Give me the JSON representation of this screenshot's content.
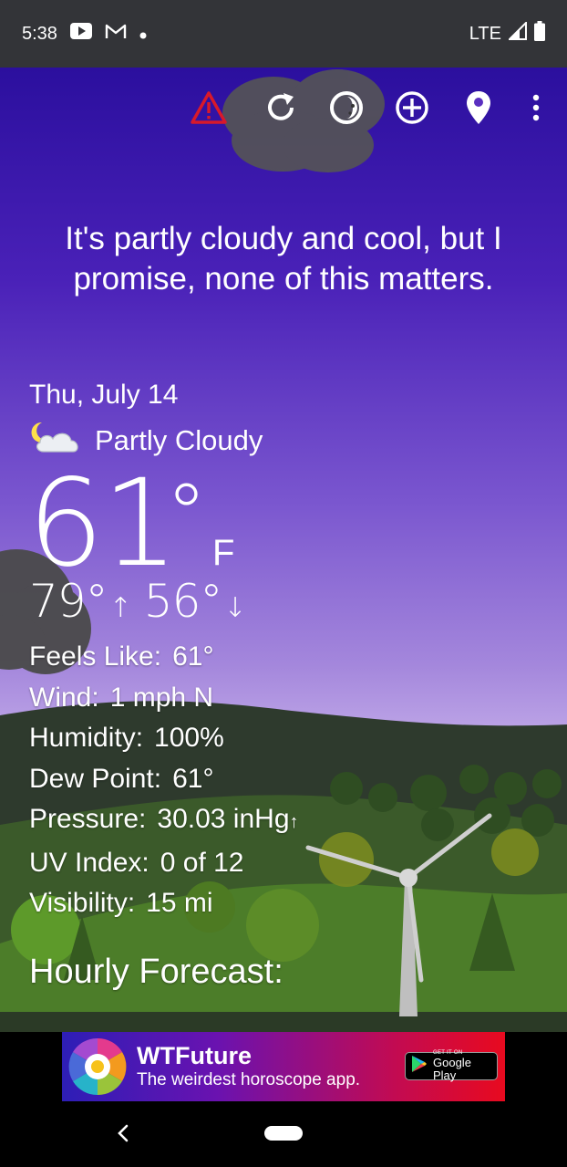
{
  "status_bar": {
    "time": "5:38",
    "network": "LTE"
  },
  "toolbar": {
    "icons": [
      "warning-icon",
      "refresh-icon",
      "theme-icon",
      "add-location-icon",
      "location-pin-icon",
      "more-vert-icon"
    ]
  },
  "quip": "It's partly cloudy and cool, but I promise, none of this matters.",
  "weather": {
    "date": "Thu, July 14",
    "condition": "Partly Cloudy",
    "temperature": "61",
    "degree_symbol": "°",
    "unit": "F",
    "high": "79°",
    "low": "56°",
    "high_arrow": "↑",
    "low_arrow": "↓"
  },
  "details": {
    "feels_like_label": "Feels Like:",
    "feels_like_value": "61°",
    "wind_label": "Wind:",
    "wind_value": "1 mph N",
    "humidity_label": "Humidity:",
    "humidity_value": "100%",
    "dew_point_label": "Dew Point:",
    "dew_point_value": "61°",
    "pressure_label": "Pressure:",
    "pressure_value": "30.03 inHg",
    "pressure_trend": "↑",
    "uv_label": "UV Index:",
    "uv_value": "0 of 12",
    "visibility_label": "Visibility:",
    "visibility_value": "15 mi"
  },
  "hourly_forecast_title": "Hourly Forecast:",
  "ad": {
    "title": "WTFuture",
    "subtitle": "The weirdest horoscope app.",
    "badge_small": "GET IT ON",
    "badge_big": "Google Play"
  },
  "colors": {
    "status_bar": "#333438",
    "sky_top": "#2b0f9e",
    "sky_bottom": "#cdb8ec",
    "warning": "#d8192a",
    "hill_dark": "#2f3b2a",
    "hill_green": "#4f8a2c"
  }
}
